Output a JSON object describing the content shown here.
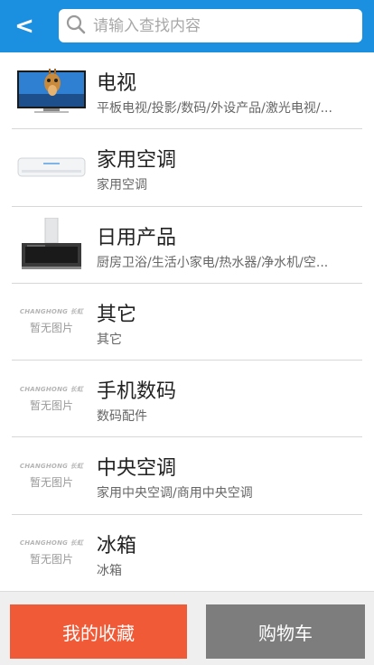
{
  "header": {
    "back_label": "<",
    "search_placeholder": "请输入查找内容"
  },
  "categories": [
    {
      "title": "电视",
      "subtitle": "平板电视/投影/数码/外设产品/激光电视/...",
      "image": "tv-product"
    },
    {
      "title": "家用空调",
      "subtitle": "家用空调",
      "image": "air-conditioner-product"
    },
    {
      "title": "日用产品",
      "subtitle": "厨房卫浴/生活小家电/热水器/净水机/空...",
      "image": "range-hood-product"
    },
    {
      "title": "其它",
      "subtitle": "其它",
      "image": "no-image"
    },
    {
      "title": "手机数码",
      "subtitle": "数码配件",
      "image": "no-image"
    },
    {
      "title": "中央空调",
      "subtitle": "家用中央空调/商用中央空调",
      "image": "no-image"
    },
    {
      "title": "冰箱",
      "subtitle": "冰箱",
      "image": "no-image"
    }
  ],
  "placeholder": {
    "brand": "CHANGHONG 长虹",
    "text": "暂无图片"
  },
  "footer": {
    "favorites_label": "我的收藏",
    "cart_label": "购物车"
  },
  "colors": {
    "header_bg": "#1b8fe0",
    "favorites_bg": "#f15a37",
    "cart_bg": "#7d7d7d"
  }
}
